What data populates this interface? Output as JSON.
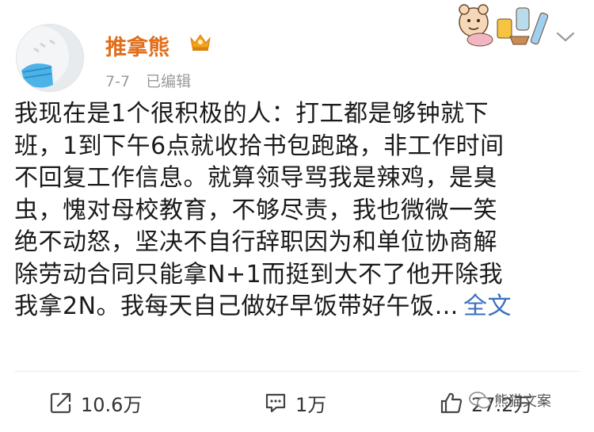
{
  "header": {
    "username": "推拿熊",
    "date": "7-7",
    "edited": "已编辑"
  },
  "post": {
    "lines": [
      "我现在是1个很积极的人：打工都是够钟就下",
      "班，1到下午6点就收拾书包跑路，非工作时间",
      "不回复工作信息。就算领导骂我是辣鸡，是臭",
      "虫，愧对母校教育，不够尽责，我也微微一笑",
      "绝不动怒，坚决不自行辞职因为和单位协商解",
      "除劳动合同只能拿N+1而挺到大不了他开除我",
      "我拿2N。我每天自己做好早饭带好午饭…"
    ],
    "full_text_link": "全文"
  },
  "footer": {
    "repost_count": "10.6万",
    "comment_count": "1万",
    "like_count": "27.2万",
    "watermark": "熊猫文案"
  }
}
